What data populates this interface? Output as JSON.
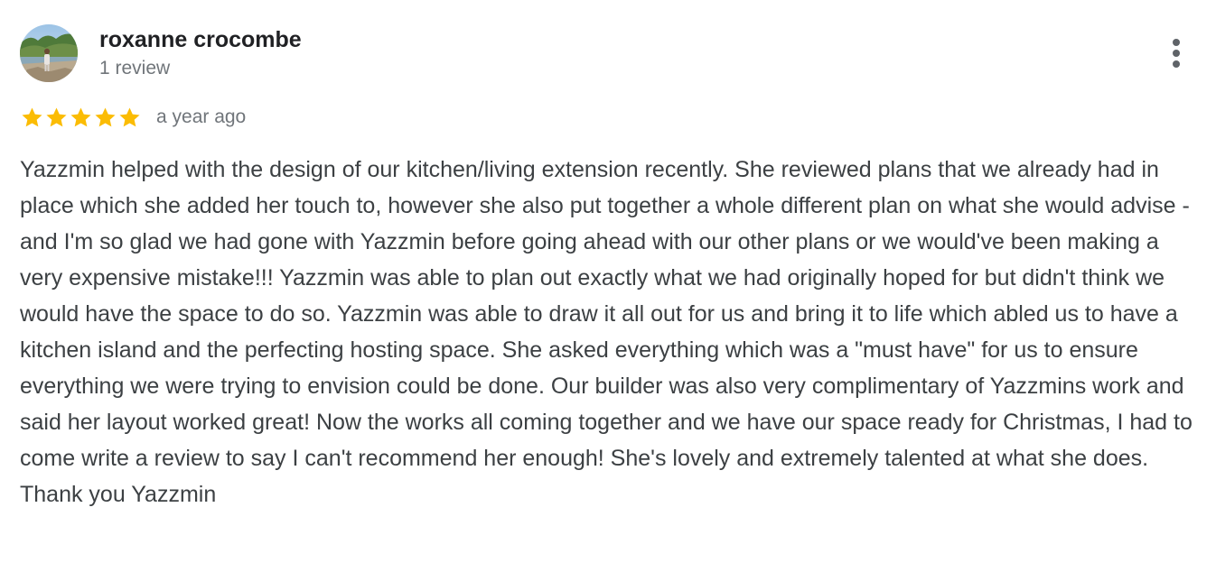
{
  "review": {
    "author": {
      "name": "roxanne crocombe",
      "review_count": "1 review",
      "avatar": "profile-photo"
    },
    "rating": {
      "value": 5,
      "max": 5,
      "star_color": "#fbbc04"
    },
    "timestamp": "a year ago",
    "text": "Yazzmin helped with the design of our kitchen/living extension recently. She reviewed plans that we already had in place which she added her touch to, however she also put together a whole different plan on what she would advise - and I'm so glad we had gone with Yazzmin before going ahead with our other plans or we would've been making a very expensive mistake!!! Yazzmin was able to plan out exactly what we had originally hoped for but didn't think we would have the space to do so. Yazzmin was able to draw it all out for us and bring it to life which abled us to have a kitchen island and the perfecting hosting space. She asked everything which was a \"must have\" for us to ensure everything we were trying to envision could be done. Our builder was also very complimentary of Yazzmins work and said her layout worked great! Now the works all coming together and we have our space ready for Christmas, I had to come write a review to say I can't recommend her enough! She's lovely and extremely talented at what she does. Thank you Yazzmin",
    "menu_icon": "more-vert-icon"
  }
}
